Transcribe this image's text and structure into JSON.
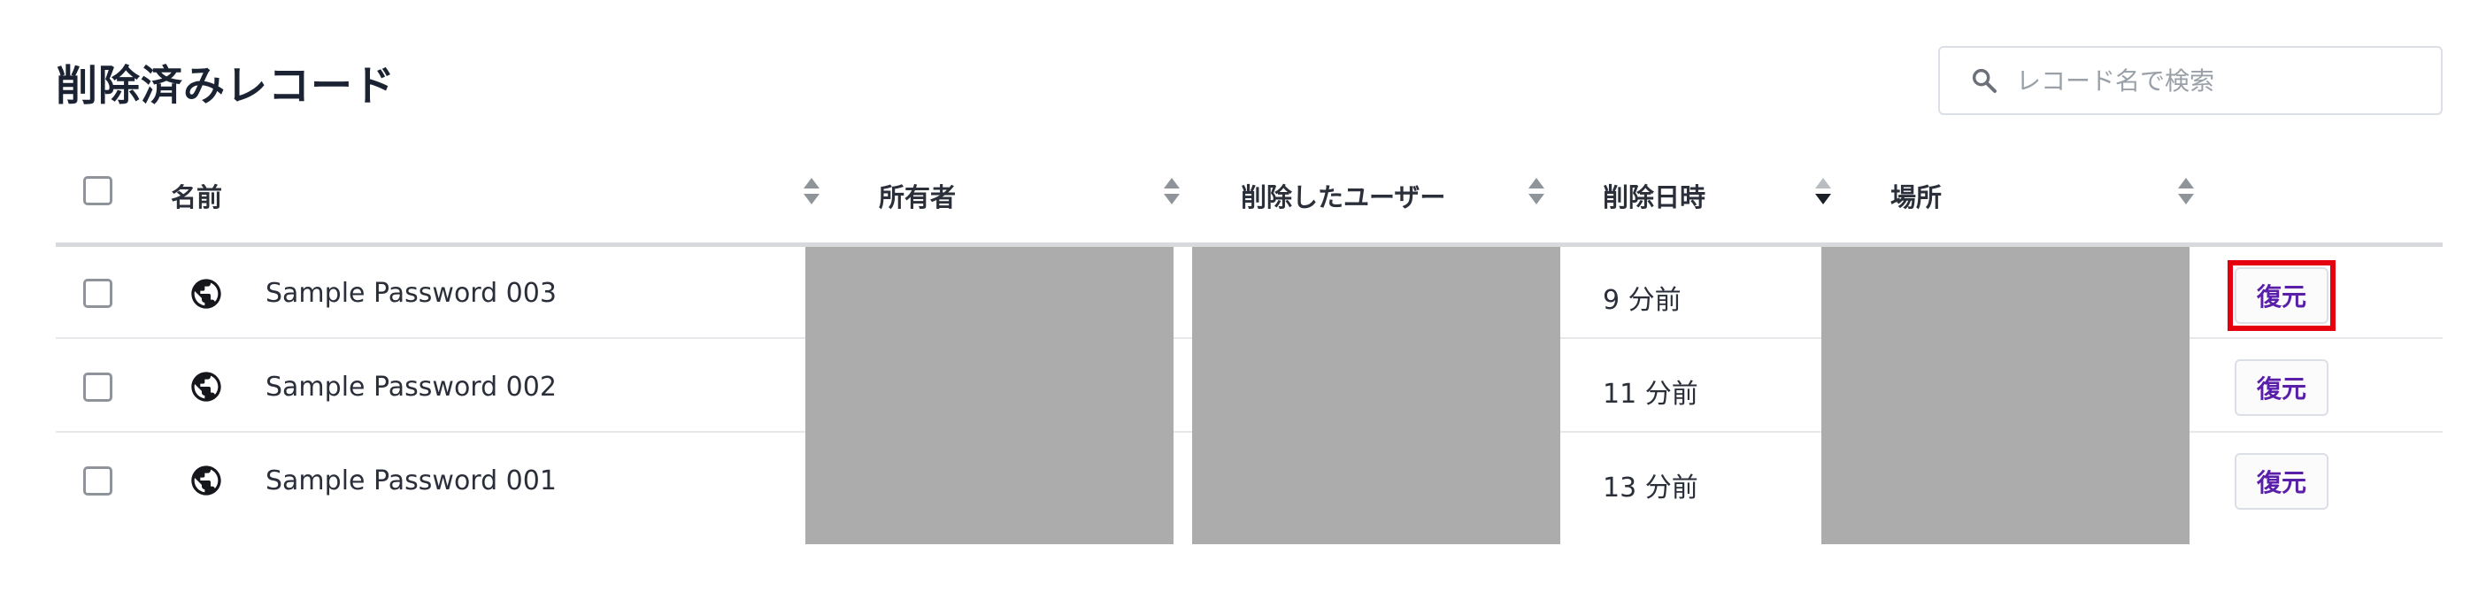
{
  "page": {
    "title": "削除済みレコード"
  },
  "search": {
    "placeholder": "レコード名で検索",
    "icon": "search-icon"
  },
  "table": {
    "columns": [
      {
        "label": "名前",
        "sort": "none"
      },
      {
        "label": "所有者",
        "sort": "none"
      },
      {
        "label": "削除したユーザー",
        "sort": "none"
      },
      {
        "label": "削除日時",
        "sort": "descending"
      },
      {
        "label": "場所",
        "sort": "none"
      }
    ],
    "rows": [
      {
        "name": "Sample Password 003",
        "icon": "globe-icon",
        "deleted_at": "9 分前",
        "action": "復元"
      },
      {
        "name": "Sample Password 002",
        "icon": "globe-icon",
        "deleted_at": "11 分前",
        "action": "復元"
      },
      {
        "name": "Sample Password 001",
        "icon": "globe-icon",
        "deleted_at": "13 分前",
        "action": "復元"
      }
    ]
  },
  "colors": {
    "accent": "#5a1fa8",
    "highlight": "#e4000f",
    "redaction": "#acacac"
  }
}
